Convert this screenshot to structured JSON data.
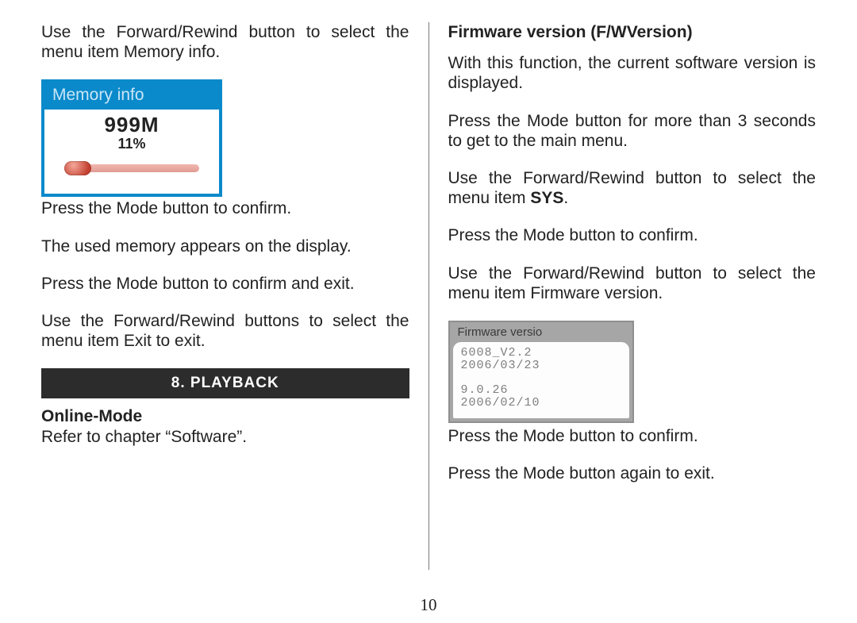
{
  "page_number": "10",
  "left": {
    "p1": "Use the Forward/Rewind button to select the menu item Memory info.",
    "mem_title": "Memory info",
    "mem_size": "999M",
    "mem_pct": "11%",
    "p2": "Press the Mode button to confirm.",
    "p3": "The used memory appears on the display.",
    "p4": "Press the Mode button to confirm and exit.",
    "p5": "Use the Forward/Rewind buttons to select the menu item Exit to exit.",
    "section_heading": "8. PLAYBACK",
    "online_heading": "Online-Mode",
    "online_text": "Refer to chapter “Software”."
  },
  "right": {
    "heading": "Firmware version (F/WVersion)",
    "p1": "With this function, the current software version is displayed.",
    "p2": "Press the Mode button for more than 3 seconds to get to the  main menu.",
    "p3a": "Use the Forward/Rewind button to select the menu item ",
    "p3b": "SYS",
    "p3c": ".",
    "p4": "Press the Mode button to confirm.",
    "p5": "Use the Forward/Rewind button to select the menu item Firmware version.",
    "fw_title": "Firmware versio",
    "fw_line1": "6008_V2.2",
    "fw_line2": "2006/03/23",
    "fw_line3": "9.0.26",
    "fw_line4": "2006/02/10",
    "p6": "Press the Mode button to confirm.",
    "p7": "Press the Mode button again to exit."
  }
}
